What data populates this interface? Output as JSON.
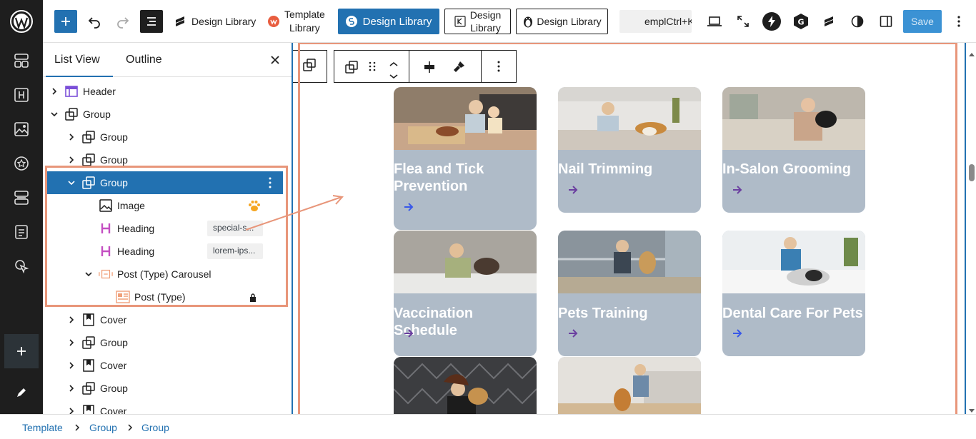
{
  "topbar": {
    "design_library_1": "Design Library",
    "template_library": "Template\nLibrary",
    "template_library_l1": "Template",
    "template_library_l2": "Library",
    "design_library_active": "Design Library",
    "design_library_box_l1": "Design",
    "design_library_box_l2": "Library",
    "design_library_penguin": "Design Library",
    "search_text": "empl",
    "shortcut": "Ctrl+K",
    "save_label": "Save"
  },
  "panel": {
    "tab_list": "List View",
    "tab_outline": "Outline",
    "rows": [
      {
        "label": "Header",
        "icon": "header-block-icon"
      },
      {
        "label": "Group",
        "icon": "group-block-icon"
      },
      {
        "label": "Group",
        "icon": "group-block-icon"
      },
      {
        "label": "Group",
        "icon": "group-block-icon"
      },
      {
        "label": "Group",
        "icon": "group-block-icon"
      },
      {
        "label": "Image",
        "icon": "image-block-icon"
      },
      {
        "label": "Heading",
        "icon": "heading-block-icon",
        "badge": "special-s..."
      },
      {
        "label": "Heading",
        "icon": "heading-block-icon",
        "badge": "lorem-ips..."
      },
      {
        "label": "Post (Type) Carousel",
        "icon": "carousel-block-icon"
      },
      {
        "label": "Post (Type)",
        "icon": "post-type-block-icon"
      },
      {
        "label": "Cover",
        "icon": "cover-block-icon"
      },
      {
        "label": "Group",
        "icon": "group-block-icon"
      },
      {
        "label": "Cover",
        "icon": "cover-block-icon"
      },
      {
        "label": "Group",
        "icon": "group-block-icon"
      },
      {
        "label": "Cover",
        "icon": "cover-block-icon"
      }
    ]
  },
  "cards": [
    {
      "title_l1": "Flea and Tick",
      "title_l2": "Prevention",
      "photo": "woman-and-girl-with-dog-on-rug"
    },
    {
      "title_l1": "Nail Trimming",
      "title_l2": "",
      "photo": "woman-with-corgi-on-floor"
    },
    {
      "title_l1": "In-Salon Grooming",
      "title_l2": "",
      "photo": "woman-with-black-dog-on-sofa"
    },
    {
      "title_l1": "Vaccination Schedule",
      "title_l2": "",
      "photo": "woman-washing-dog"
    },
    {
      "title_l1": "Pets Training",
      "title_l2": "",
      "photo": "woman-training-dog-outdoors"
    },
    {
      "title_l1": "Dental Care For Pets",
      "title_l2": "",
      "photo": "vet-examining-dog"
    },
    {
      "photo": "woman-with-puppy"
    },
    {
      "photo": "woman-with-corgi-on-sofa-floor"
    }
  ],
  "breadcrumb": [
    "Template",
    "Group",
    "Group"
  ],
  "colors": {
    "accent": "#2271b1",
    "highlight_border": "#e8967a",
    "card_bg": "#afbbc8",
    "arrow_blue": "#3858e9",
    "arrow_purple": "#6b3fa0",
    "sidebar_bg": "#1e1e1e"
  }
}
